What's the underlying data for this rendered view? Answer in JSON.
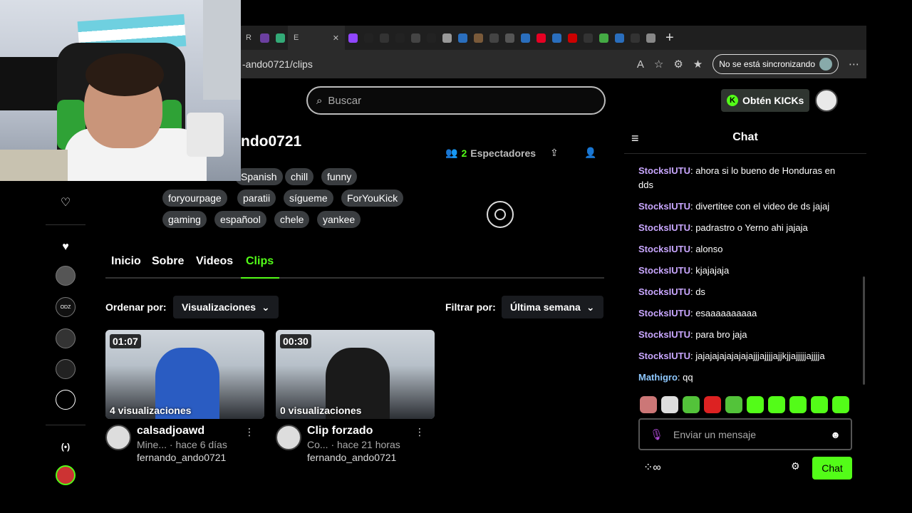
{
  "browser": {
    "url": "-ando0721/clips",
    "sync_label": "No se está sincronizando",
    "active_tab_letter": "E"
  },
  "search": {
    "placeholder": "Buscar"
  },
  "kicks_button": "Obtén KICKs",
  "channel": {
    "name": "ndo0721",
    "viewers_count": "2",
    "viewers_label": "Espectadores",
    "tags": [
      "Spanish",
      "chill",
      "funny",
      "foryourpage",
      "paratii",
      "sígueme",
      "ForYouKick",
      "gaming",
      "españool",
      "chele",
      "yankee"
    ]
  },
  "tabs": [
    "Inicio",
    "Sobre",
    "Videos",
    "Clips"
  ],
  "sort": {
    "label": "Ordenar por:",
    "value": "Visualizaciones"
  },
  "filter": {
    "label": "Filtrar por:",
    "value": "Última semana"
  },
  "clips": [
    {
      "duration": "01:07",
      "views": "4 visualizaciones",
      "title": "calsadjoawd",
      "sub": "Mine... · hace 6 días",
      "author": "fernando_ando0721"
    },
    {
      "duration": "00:30",
      "views": "0 visualizaciones",
      "title": "Clip forzado",
      "sub": "Co... · hace 21 horas",
      "author": "fernando_ando0721"
    }
  ],
  "chat": {
    "title": "Chat",
    "messages": [
      {
        "user": "StocksIUTU",
        "text": "ahora si lo bueno de Honduras en dds"
      },
      {
        "user": "StocksIUTU",
        "text": "divertitee con el video de ds jajaj"
      },
      {
        "user": "StocksIUTU",
        "text": "padrastro o Yerno ahi jajaja"
      },
      {
        "user": "StocksIUTU",
        "text": "alonso"
      },
      {
        "user": "StocksIUTU",
        "text": "kjajajaja"
      },
      {
        "user": "StocksIUTU",
        "text": "ds"
      },
      {
        "user": "StocksIUTU",
        "text": "esaaaaaaaaaa"
      },
      {
        "user": "StocksIUTU",
        "text": "para bro jaja"
      },
      {
        "user": "StocksIUTU",
        "text": "jajajajajajajajajjjajjjjajjkjjajjjjjajjjja"
      },
      {
        "user": "Mathigro",
        "text": "qq"
      }
    ],
    "input_placeholder": "Enviar un mensaje",
    "send_label": "Chat"
  },
  "colors": {
    "accent": "#53fc18",
    "user_purple": "#c9a7ff",
    "user_blue": "#8ec8ff"
  }
}
